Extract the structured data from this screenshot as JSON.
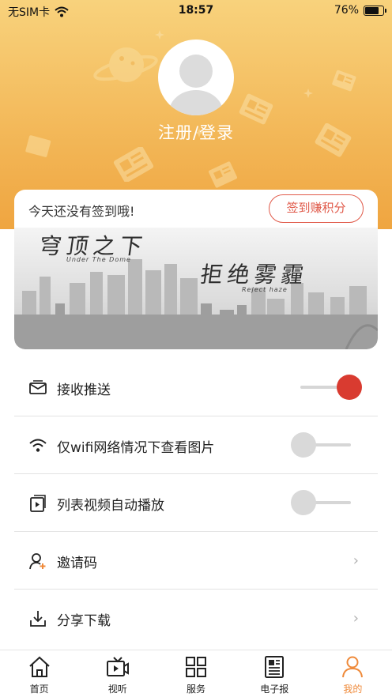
{
  "status_bar": {
    "carrier": "无SIM卡",
    "time": "18:57",
    "battery_percent": "76%",
    "battery_level": 0.76
  },
  "profile": {
    "login_label": "注册/登录"
  },
  "signin": {
    "prompt": "今天还没有签到哦!",
    "button_label": "签到赚积分"
  },
  "banner": {
    "title_cn_1": "穹顶之下",
    "title_en_1": "Under The Dome",
    "title_cn_2": "拒绝雾霾",
    "title_en_2": "Reject haze"
  },
  "settings": {
    "items": [
      {
        "label": "接收推送",
        "icon": "envelope-icon",
        "type": "toggle",
        "on": true
      },
      {
        "label": "仅wifi网络情况下查看图片",
        "icon": "wifi-icon",
        "type": "toggle",
        "on": false
      },
      {
        "label": "列表视频自动播放",
        "icon": "video-play-icon",
        "type": "toggle",
        "on": false
      },
      {
        "label": "邀请码",
        "icon": "invite-user-icon",
        "type": "link",
        "chevron": "›"
      },
      {
        "label": "分享下载",
        "icon": "download-icon",
        "type": "link",
        "chevron": "›"
      }
    ]
  },
  "tabbar": {
    "tabs": [
      {
        "label": "首页",
        "icon": "home-icon",
        "active": false
      },
      {
        "label": "视听",
        "icon": "tv-play-icon",
        "active": false
      },
      {
        "label": "服务",
        "icon": "grid-icon",
        "active": false
      },
      {
        "label": "电子报",
        "icon": "newspaper-icon",
        "active": false
      },
      {
        "label": "我的",
        "icon": "person-icon",
        "active": true
      }
    ]
  },
  "colors": {
    "accent": "#ef8a3a",
    "toggle_on": "#d93b30",
    "signin_red": "#e05a4a",
    "header_top": "#f8d27c",
    "header_bottom": "#efa540"
  }
}
